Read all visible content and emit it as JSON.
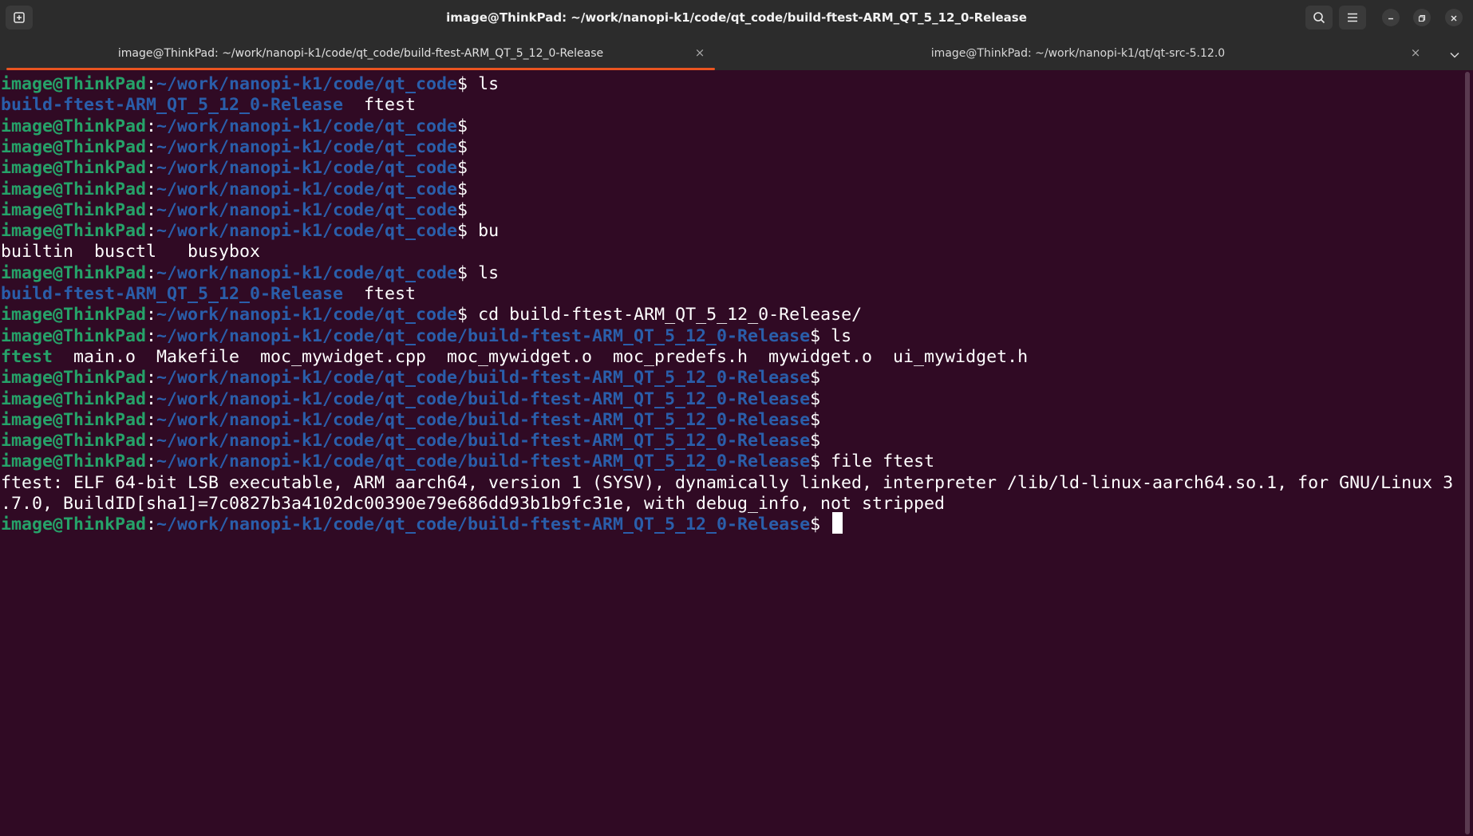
{
  "window": {
    "title": "image@ThinkPad: ~/work/nanopi-k1/code/qt_code/build-ftest-ARM_QT_5_12_0-Release",
    "buttons": {
      "new_tab_icon": "new-tab-icon",
      "search_icon": "search-icon",
      "menu_icon": "hamburger-menu-icon",
      "minimize_icon": "minimize-icon",
      "maximize_icon": "maximize-icon",
      "close_icon": "close-icon"
    }
  },
  "tabs": [
    {
      "label": "image@ThinkPad: ~/work/nanopi-k1/code/qt_code/build-ftest-ARM_QT_5_12_0-Release",
      "active": true,
      "close": "×"
    },
    {
      "label": "image@ThinkPad: ~/work/nanopi-k1/qt/qt-src-5.12.0",
      "active": false,
      "close": "×"
    }
  ],
  "colors": {
    "background": "#300a24",
    "user_host": "#26a269",
    "path": "#2a5eaa",
    "active_tab_indicator": "#e95420"
  },
  "terminal": {
    "user": "image@ThinkPad",
    "path_qt_code": "~/work/nanopi-k1/code/qt_code",
    "path_build": "~/work/nanopi-k1/code/qt_code/build-ftest-ARM_QT_5_12_0-Release",
    "lines": [
      {
        "type": "prompt",
        "path": "~/work/nanopi-k1/code/qt_code",
        "cmd": " ls"
      },
      {
        "type": "dirs",
        "text": "build-ftest-ARM_QT_5_12_0-Release",
        "rest": "  ftest"
      },
      {
        "type": "prompt",
        "path": "~/work/nanopi-k1/code/qt_code",
        "cmd": ""
      },
      {
        "type": "prompt",
        "path": "~/work/nanopi-k1/code/qt_code",
        "cmd": ""
      },
      {
        "type": "prompt",
        "path": "~/work/nanopi-k1/code/qt_code",
        "cmd": ""
      },
      {
        "type": "prompt",
        "path": "~/work/nanopi-k1/code/qt_code",
        "cmd": ""
      },
      {
        "type": "prompt",
        "path": "~/work/nanopi-k1/code/qt_code",
        "cmd": ""
      },
      {
        "type": "prompt",
        "path": "~/work/nanopi-k1/code/qt_code",
        "cmd": " bu"
      },
      {
        "type": "plain",
        "text": "builtin  busctl   busybox"
      },
      {
        "type": "prompt",
        "path": "~/work/nanopi-k1/code/qt_code",
        "cmd": " ls"
      },
      {
        "type": "dirs",
        "text": "build-ftest-ARM_QT_5_12_0-Release",
        "rest": "  ftest"
      },
      {
        "type": "prompt",
        "path": "~/work/nanopi-k1/code/qt_code",
        "cmd": " cd build-ftest-ARM_QT_5_12_0-Release/"
      },
      {
        "type": "prompt",
        "path": "~/work/nanopi-k1/code/qt_code/build-ftest-ARM_QT_5_12_0-Release",
        "cmd": " ls"
      },
      {
        "type": "exec",
        "exec": "ftest",
        "text": "  main.o  Makefile  moc_mywidget.cpp  moc_mywidget.o  moc_predefs.h  mywidget.o  ui_mywidget.h"
      },
      {
        "type": "prompt",
        "path": "~/work/nanopi-k1/code/qt_code/build-ftest-ARM_QT_5_12_0-Release",
        "cmd": ""
      },
      {
        "type": "prompt",
        "path": "~/work/nanopi-k1/code/qt_code/build-ftest-ARM_QT_5_12_0-Release",
        "cmd": ""
      },
      {
        "type": "prompt",
        "path": "~/work/nanopi-k1/code/qt_code/build-ftest-ARM_QT_5_12_0-Release",
        "cmd": ""
      },
      {
        "type": "prompt",
        "path": "~/work/nanopi-k1/code/qt_code/build-ftest-ARM_QT_5_12_0-Release",
        "cmd": ""
      },
      {
        "type": "prompt",
        "path": "~/work/nanopi-k1/code/qt_code/build-ftest-ARM_QT_5_12_0-Release",
        "cmd": " file ftest"
      },
      {
        "type": "plain",
        "text": "ftest: ELF 64-bit LSB executable, ARM aarch64, version 1 (SYSV), dynamically linked, interpreter /lib/ld-linux-aarch64.so.1, for GNU/Linux 3"
      },
      {
        "type": "plain",
        "text": ".7.0, BuildID[sha1]=7c0827b3a4102dc00390e79e686dd93b1b9fc31e, with debug_info, not stripped"
      },
      {
        "type": "prompt",
        "path": "~/work/nanopi-k1/code/qt_code/build-ftest-ARM_QT_5_12_0-Release",
        "cmd": " ",
        "cursor": true
      }
    ]
  }
}
